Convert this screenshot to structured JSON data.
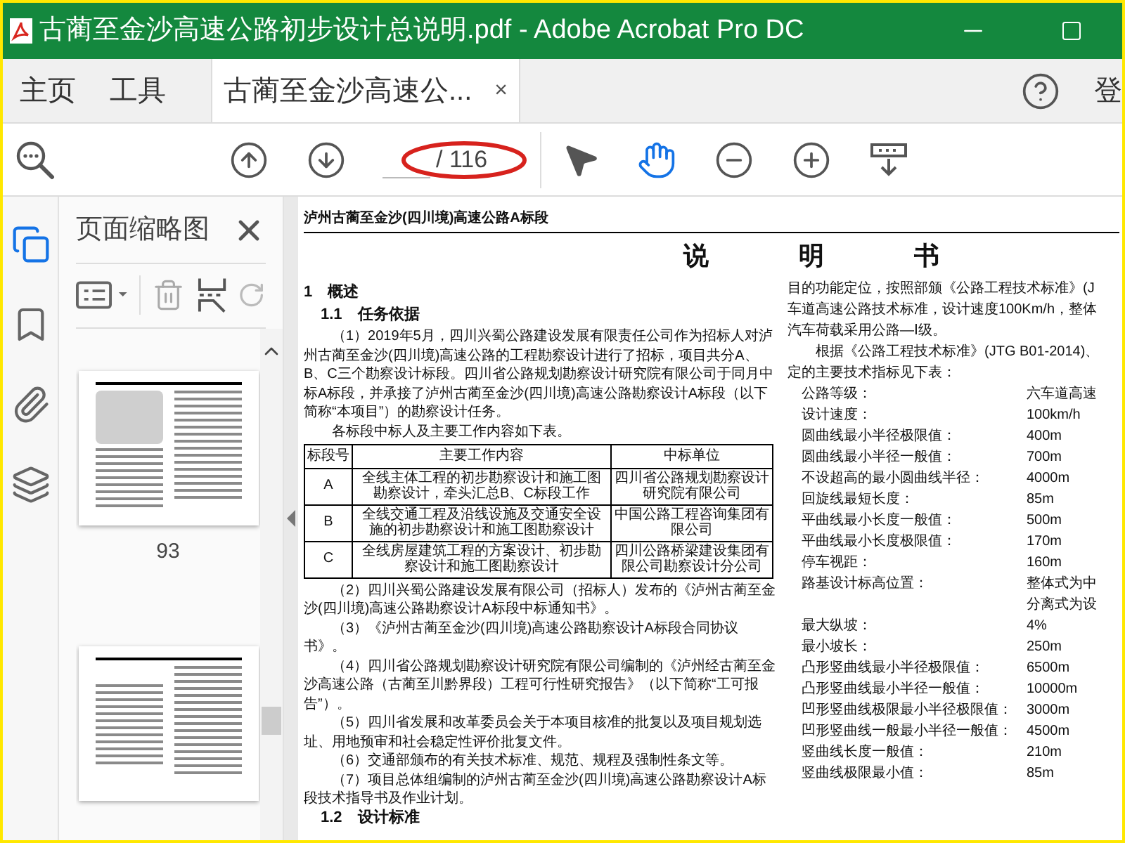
{
  "window": {
    "title": "古蔺至金沙高速公路初步设计总说明.pdf - Adobe Acrobat Pro DC"
  },
  "tabs": [
    {
      "label": "主页",
      "kind": "menu",
      "selected": false
    },
    {
      "label": "工具",
      "kind": "menu",
      "selected": false
    },
    {
      "label": "古蔺至金沙高速公...",
      "kind": "document",
      "selected": true,
      "close": "×"
    }
  ],
  "account_label": "登",
  "toolbar": {
    "page_total": "/ 116",
    "tools": [
      {
        "kind": "select",
        "selected": false
      },
      {
        "kind": "hand",
        "selected": true
      }
    ]
  },
  "rail": [
    {
      "kind": "pages",
      "selected": true
    },
    {
      "kind": "bookmarks",
      "selected": false
    },
    {
      "kind": "attachments",
      "selected": false
    },
    {
      "kind": "layers",
      "selected": false
    }
  ],
  "panel": {
    "title": "页面缩略图",
    "thumbnails": [
      {
        "kind": "page",
        "label": "93"
      },
      {
        "kind": "page"
      }
    ]
  },
  "document": {
    "header": "泸州古蔺至金沙(四川境)高速公路A标段",
    "title": "说明书",
    "left": [
      {
        "kind": "h1",
        "text": "1　概述"
      },
      {
        "kind": "h2",
        "text": "1.1　任务依据"
      },
      {
        "kind": "p",
        "text": "（1）2019年5月，四川兴蜀公路建设发展有限责任公司作为招标人对泸州古蔺至金沙(四川境)高速公路的工程勘察设计进行了招标，项目共分A、B、C三个勘察设计标段。四川省公路规划勘察设计研究院有限公司于同月中标A标段，并承接了泸州古蔺至金沙(四川境)高速公路勘察设计A标段（以下简称“本项目”）的勘察设计任务。"
      },
      {
        "kind": "p",
        "text": "各标段中标人及主要工作内容如下表。"
      },
      {
        "kind": "table",
        "columns": [
          "标段号",
          "主要工作内容",
          "中标单位"
        ],
        "rows": [
          [
            "A",
            "全线主体工程的初步勘察设计和施工图勘察设计，牵头汇总B、C标段工作",
            "四川省公路规划勘察设计研究院有限公司"
          ],
          [
            "B",
            "全线交通工程及沿线设施及交通安全设施的初步勘察设计和施工图勘察设计",
            "中国公路工程咨询集团有限公司"
          ],
          [
            "C",
            "全线房屋建筑工程的方案设计、初步勘察设计和施工图勘察设计",
            "四川公路桥梁建设集团有限公司勘察设计分公司"
          ]
        ]
      },
      {
        "kind": "p",
        "text": "（2）四川兴蜀公路建设发展有限公司（招标人）发布的《泸州古蔺至金沙(四川境)高速公路勘察设计A标段中标通知书》。"
      },
      {
        "kind": "p",
        "text": "（3）《泸州古蔺至金沙(四川境)高速公路勘察设计A标段合同协议书》。"
      },
      {
        "kind": "p",
        "text": "（4）四川省公路规划勘察设计研究院有限公司编制的《泸州经古蔺至金沙高速公路（古蔺至川黔界段）工程可行性研究报告》（以下简称“工可报告”）。"
      },
      {
        "kind": "p",
        "text": "（5）四川省发展和改革委员会关于本项目核准的批复以及项目规划选址、用地预审和社会稳定性评价批复文件。"
      },
      {
        "kind": "p",
        "text": "（6）交通部颁布的有关技术标准、规范、规程及强制性条文等。"
      },
      {
        "kind": "p",
        "text": "（7）项目总体组编制的泸州古蔺至金沙(四川境)高速公路勘察设计A标段技术指导书及作业计划。"
      },
      {
        "kind": "h2",
        "text": "1.2　设计标准"
      }
    ],
    "right_lines": [
      {
        "kind": "line",
        "text": "目的功能定位，按照部颁《公路工程技术标准》(J"
      },
      {
        "kind": "line",
        "text": "车道高速公路技术标准，设计速度100Km/h，整体"
      },
      {
        "kind": "line",
        "text": "汽车荷载采用公路—Ⅰ级。"
      },
      {
        "kind": "indent",
        "text": "根据《公路工程技术标准》(JTG B01-2014)、"
      },
      {
        "kind": "line",
        "text": "定的主要技术指标见下表："
      }
    ],
    "specs": [
      {
        "label": "公路等级：",
        "value": "六车道高速"
      },
      {
        "label": "设计速度：",
        "value": "100km/h"
      },
      {
        "label": "圆曲线最小半径极限值：",
        "value": "400m"
      },
      {
        "label": "圆曲线最小半径一般值：",
        "value": "700m"
      },
      {
        "label": "不设超高的最小圆曲线半径：",
        "value": "4000m"
      },
      {
        "label": "回旋线最短长度：",
        "value": "85m"
      },
      {
        "label": "平曲线最小长度一般值：",
        "value": "500m"
      },
      {
        "label": "平曲线最小长度极限值：",
        "value": "170m"
      },
      {
        "label": "停车视距：",
        "value": "160m"
      },
      {
        "label": "路基设计标高位置：",
        "value": "整体式为中"
      },
      {
        "value": "分离式为设"
      },
      {
        "label": "最大纵坡：",
        "value": "4%"
      },
      {
        "label": "最小坡长：",
        "value": "250m"
      },
      {
        "label": "凸形竖曲线最小半径极限值：",
        "value": "6500m"
      },
      {
        "label": "凸形竖曲线最小半径一般值：",
        "value": "10000m"
      },
      {
        "label": "凹形竖曲线极限最小半径极限值：",
        "value": "3000m"
      },
      {
        "label": "凹形竖曲线一般最小半径一般值：",
        "value": "4500m"
      },
      {
        "label": "竖曲线长度一般值：",
        "value": "210m"
      },
      {
        "label": "竖曲线极限最小值：",
        "value": "85m"
      }
    ]
  }
}
